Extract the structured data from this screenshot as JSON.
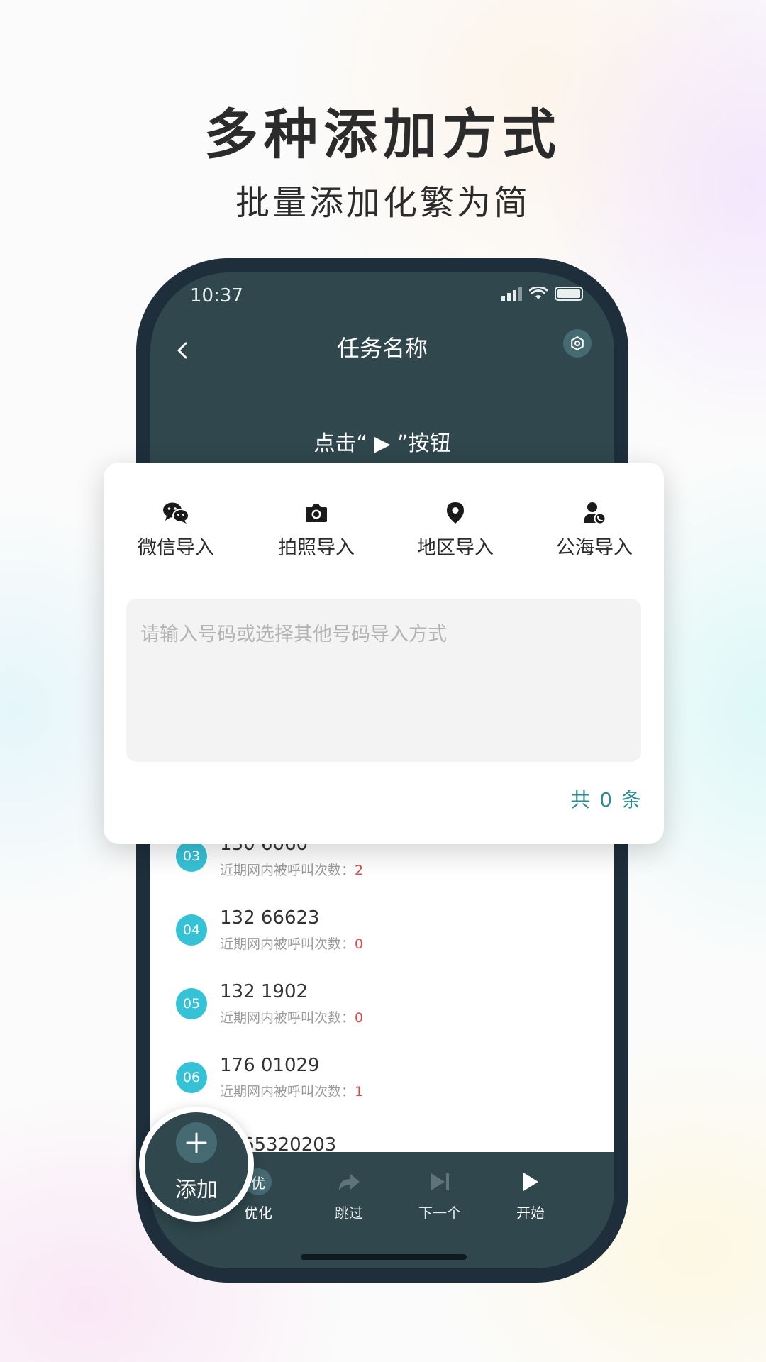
{
  "promo": {
    "title": "多种添加方式",
    "subtitle": "批量添加化繁为简"
  },
  "status_bar": {
    "time": "10:37"
  },
  "header": {
    "title": "任务名称"
  },
  "hint": "点击“ ▶ ”按钮",
  "import_card": {
    "options": [
      {
        "label": "微信导入",
        "icon": "wechat-icon"
      },
      {
        "label": "拍照导入",
        "icon": "camera-icon"
      },
      {
        "label": "地区导入",
        "icon": "location-pin-icon"
      },
      {
        "label": "公海导入",
        "icon": "user-phone-icon"
      }
    ],
    "input_placeholder": "请输入号码或选择其他号码导入方式",
    "total": "共 0 条"
  },
  "list": {
    "rows": [
      {
        "num": "03",
        "phone": "130    6060",
        "sub_label": "近期网内被呼叫次数：",
        "count": "2"
      },
      {
        "num": "04",
        "phone": "132    66623",
        "sub_label": "近期网内被呼叫次数：",
        "count": "0"
      },
      {
        "num": "05",
        "phone": "132    1902",
        "sub_label": "近期网内被呼叫次数：",
        "count": "0"
      },
      {
        "num": "06",
        "phone": "176    01029",
        "sub_label": "近期网内被呼叫次数：",
        "count": "1"
      }
    ],
    "partial_row": "65320203"
  },
  "toolbar": {
    "add_label": "添加",
    "optimize_badge": "优",
    "optimize_label": "优化",
    "skip_label": "跳过",
    "next_label": "下一个",
    "start_label": "开始"
  },
  "colors": {
    "screen_bg": "#2f474d",
    "row_badge": "#35c2d6",
    "count_red": "#e04848",
    "total_teal": "#2e8a8e"
  }
}
